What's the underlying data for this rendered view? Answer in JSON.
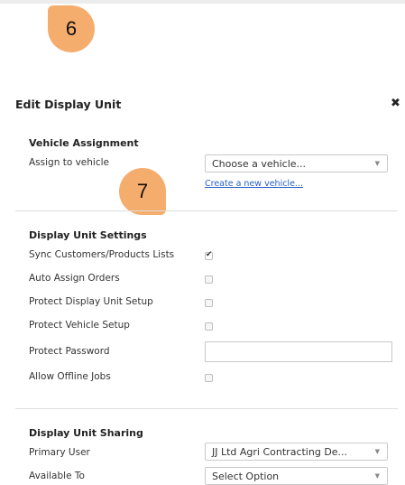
{
  "callouts": {
    "step6": "6",
    "step7": "7"
  },
  "dialog": {
    "title": "Edit Display Unit",
    "close_icon": "close-icon"
  },
  "vehicle_assignment": {
    "heading": "Vehicle Assignment",
    "assign_label": "Assign to vehicle",
    "vehicle_select_value": "Choose a vehicle...",
    "create_link": "Create a new vehicle..."
  },
  "display_settings": {
    "heading": "Display Unit Settings",
    "items": [
      {
        "label": "Sync Customers/Products Lists",
        "checked": true
      },
      {
        "label": "Auto Assign Orders",
        "checked": false
      },
      {
        "label": "Protect Display Unit Setup",
        "checked": false
      },
      {
        "label": "Protect Vehicle Setup",
        "checked": false
      },
      {
        "label": "Protect Password",
        "checked": null
      },
      {
        "label": "Allow Offline Jobs",
        "checked": false
      }
    ],
    "password_value": ""
  },
  "sharing": {
    "heading": "Display Unit Sharing",
    "primary_user_label": "Primary User",
    "primary_user_value": "JJ Ltd Agri Contracting De...",
    "available_to_label": "Available To",
    "available_to_value": "Select Option"
  },
  "colors": {
    "callout": "#f5ad6e",
    "link": "#2a5fc7"
  }
}
